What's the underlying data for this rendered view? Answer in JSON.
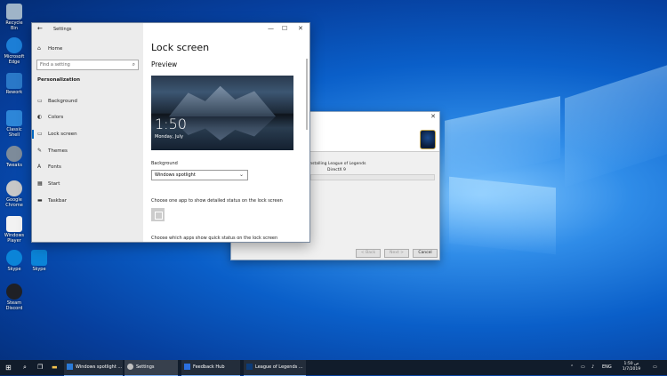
{
  "desktop_icons": [
    {
      "label": "Recycle Bin",
      "color": "#9fb4c8"
    },
    {
      "label": "Microsoft Edge",
      "color": "#1c7ed6"
    },
    {
      "label": "Rework",
      "color": "#2a78c8"
    },
    {
      "label": "Classic Shell",
      "color": "#2d86d8"
    },
    {
      "label": "Tweaks",
      "color": "#7d8b9a"
    },
    {
      "label": "Google Chrome",
      "color": "#c7c7c7"
    },
    {
      "label": "Windows Player",
      "color": "#f2f2f2"
    },
    {
      "label": "Skype",
      "color": "#0b84d8"
    },
    {
      "label": "Skype",
      "color": "#0b84d8"
    },
    {
      "label": "Steam Discord",
      "color": "#1f2025"
    }
  ],
  "settings": {
    "title": "Settings",
    "nav": {
      "home": "Home",
      "search_placeholder": "Find a setting",
      "section": "Personalization",
      "items": [
        {
          "label": "Background",
          "icon": "picture-icon"
        },
        {
          "label": "Colors",
          "icon": "palette-icon"
        },
        {
          "label": "Lock screen",
          "icon": "monitor-icon",
          "active": true
        },
        {
          "label": "Themes",
          "icon": "brush-icon"
        },
        {
          "label": "Fonts",
          "icon": "font-icon"
        },
        {
          "label": "Start",
          "icon": "start-icon"
        },
        {
          "label": "Taskbar",
          "icon": "taskbar-icon"
        }
      ]
    },
    "content": {
      "heading": "Lock screen",
      "preview_heading": "Preview",
      "preview_time": "1:50",
      "preview_date": "Monday, July",
      "background_label": "Background",
      "background_value": "Windows spotlight",
      "detailed_status_text": "Choose one app to show detailed status on the lock screen",
      "quick_status_text": "Choose which apps show quick status on the lock screen"
    }
  },
  "installer": {
    "status": "Installing League of Legends",
    "sub": "DirectX 9",
    "back_label": "< Back",
    "next_label": "Next >",
    "cancel_label": "Cancel"
  },
  "taskbar": {
    "apps": [
      {
        "label": "Windows spotlight ...",
        "color": "#2a7ad8"
      },
      {
        "label": "Settings",
        "color": "#c0c0c0"
      },
      {
        "label": "Feedback Hub",
        "color": "#2b6fe0"
      },
      {
        "label": "League of Legends ...",
        "color": "#0c3b78"
      }
    ],
    "tray_time": "1:50 ص",
    "tray_date": "1/7/2019",
    "language": "ENG",
    "accent": "#7fb6ff"
  }
}
